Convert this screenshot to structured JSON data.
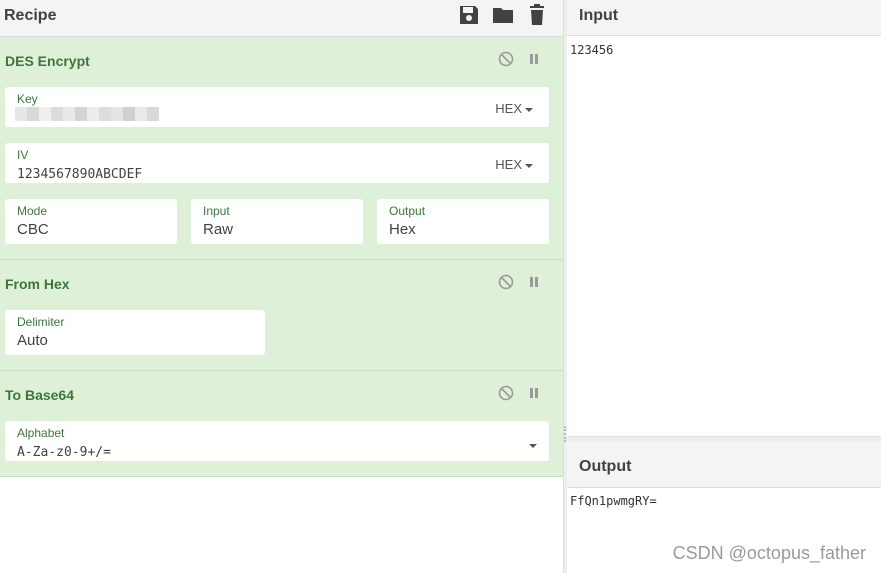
{
  "recipe": {
    "title": "Recipe",
    "header_icons": [
      "save-icon",
      "folder-icon",
      "trash-icon"
    ]
  },
  "operations": [
    {
      "title": "DES Encrypt",
      "fields": {
        "key": {
          "label": "Key",
          "value": "",
          "format": "HEX"
        },
        "iv": {
          "label": "IV",
          "value": "1234567890ABCDEF",
          "format": "HEX"
        },
        "mode": {
          "label": "Mode",
          "value": "CBC"
        },
        "input": {
          "label": "Input",
          "value": "Raw"
        },
        "output": {
          "label": "Output",
          "value": "Hex"
        }
      }
    },
    {
      "title": "From Hex",
      "fields": {
        "delimiter": {
          "label": "Delimiter",
          "value": "Auto"
        }
      }
    },
    {
      "title": "To Base64",
      "fields": {
        "alphabet": {
          "label": "Alphabet",
          "value": "A-Za-z0-9+/="
        }
      }
    }
  ],
  "input": {
    "title": "Input",
    "text": "123456"
  },
  "output": {
    "title": "Output",
    "text": "FfQn1pwmgRY="
  },
  "watermark": "CSDN @octopus_father",
  "colors": {
    "op_background": "#dff0d8",
    "op_title": "#3c763d",
    "header_background": "#f4f4f4"
  }
}
